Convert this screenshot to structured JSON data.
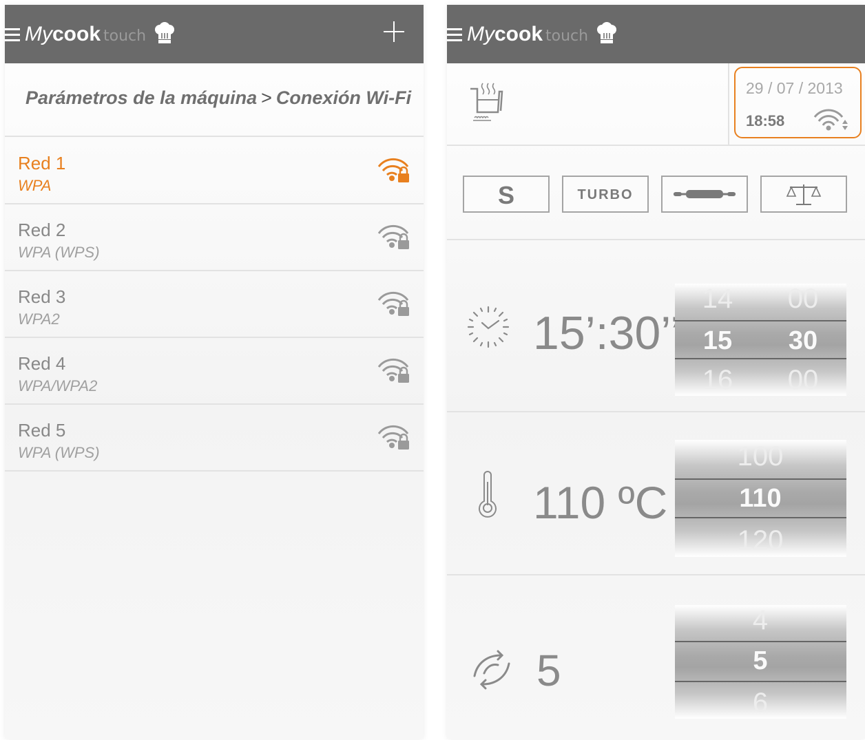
{
  "brand": {
    "my": "My",
    "cook": "cook",
    "touch": "touch"
  },
  "left": {
    "breadcrumb": {
      "parent": "Parámetros de la máquina",
      "separator": ">",
      "current": "Conexión Wi-Fi"
    },
    "networks": [
      {
        "name": "Red 1",
        "security": "WPA",
        "active": true
      },
      {
        "name": "Red 2",
        "security": "WPA (WPS)",
        "active": false
      },
      {
        "name": "Red 3",
        "security": "WPA2",
        "active": false
      },
      {
        "name": "Red 4",
        "security": "WPA/WPA2",
        "active": false
      },
      {
        "name": "Red 5",
        "security": "WPA (WPS)",
        "active": false
      }
    ]
  },
  "right": {
    "status": {
      "date": "29 / 07 / 2013",
      "time": "18:58"
    },
    "modes": {
      "s": "S",
      "turbo": "TURBO"
    },
    "timer": {
      "display": "15’:30’’",
      "minutes": [
        "14",
        "15",
        "16"
      ],
      "seconds": [
        "00",
        "30",
        "00"
      ]
    },
    "temperature": {
      "display": "110 ºC",
      "values": [
        "100",
        "110",
        "120"
      ]
    },
    "speed": {
      "display": "5",
      "values": [
        "4",
        "5",
        "6"
      ]
    }
  },
  "colors": {
    "accent": "#e8801f",
    "appbar": "#6a6a6a",
    "text": "#8a8a8a"
  }
}
